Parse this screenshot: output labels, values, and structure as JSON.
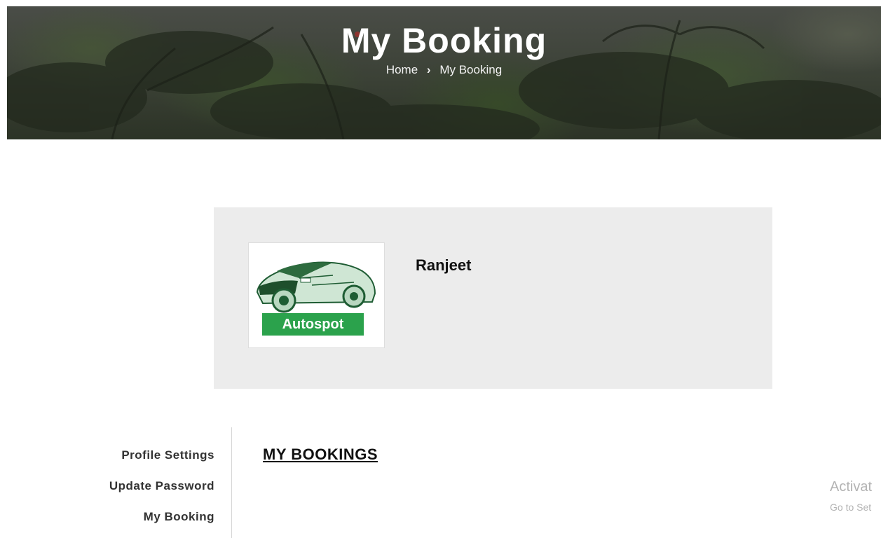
{
  "hero": {
    "title": "My Booking",
    "breadcrumb": {
      "home": "Home",
      "separator": "›",
      "current": "My Booking"
    }
  },
  "profile": {
    "logo_text": "Autospot",
    "name": "Ranjeet"
  },
  "sidebar": {
    "items": [
      {
        "label": "Profile Settings"
      },
      {
        "label": "Update Password"
      },
      {
        "label": "My Booking"
      }
    ]
  },
  "main": {
    "section_title": "MY BOOKINGS"
  },
  "watermark": {
    "line1": "Activat",
    "line2": "Go to Set"
  },
  "colors": {
    "brand_green": "#2ba24c",
    "card_bg": "#ececec"
  }
}
